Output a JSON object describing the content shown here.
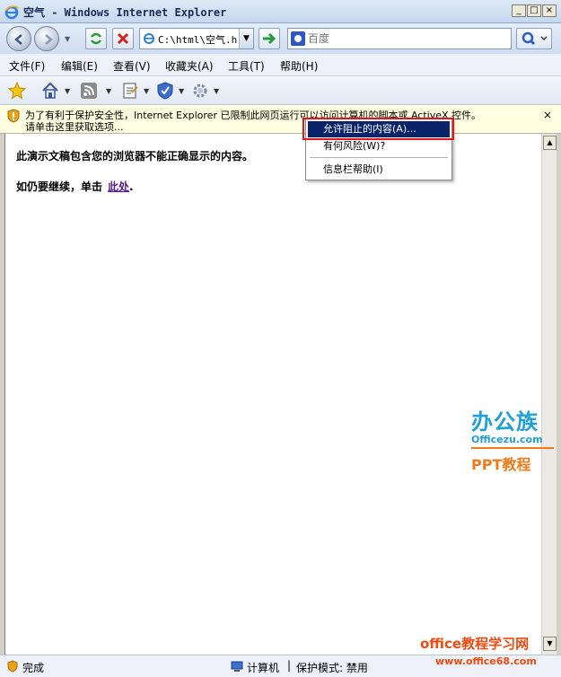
{
  "window": {
    "title": "空气 - Windows Internet Explorer",
    "min_label": "_",
    "max_label": "□",
    "close_label": "×"
  },
  "address": {
    "url": "C:\\html\\空气.ht",
    "search_placeholder": "百度"
  },
  "menu": [
    {
      "label": "文件(F)"
    },
    {
      "label": "编辑(E)"
    },
    {
      "label": "查看(V)"
    },
    {
      "label": "收藏夹(A)"
    },
    {
      "label": "工具(T)"
    },
    {
      "label": "帮助(H)"
    }
  ],
  "command_icons": [
    "favorites-star-icon",
    "home-icon",
    "rss-feed-icon",
    "page-icon",
    "safety-shield-icon",
    "tools-gear-icon"
  ],
  "infobar": {
    "line1": "为了有利于保护安全性，Internet Explorer 已限制此网页运行可以访问计算机的脚本或 ActiveX 控件。",
    "line2": "请单击这里获取选项...",
    "close": "×"
  },
  "context_menu": {
    "items": [
      {
        "label": "允许阻止的内容(A)..."
      },
      {
        "label": "有何风险(W)?"
      },
      {
        "label": "信息栏帮助(I)"
      }
    ]
  },
  "content": {
    "line1": "此演示文稿包含您的浏览器不能正确显示的内容。",
    "line2_prefix": "如仍要继续，单击",
    "link": "此处",
    "line2_suffix": "."
  },
  "watermark": {
    "logo_big": "办公族",
    "logo_domain": "Officezu.com",
    "logo_ppt": "PPT教程",
    "site_name": "office教程学习网",
    "site_url": "www.office68.com"
  },
  "status": {
    "done": "完成",
    "zone": "计算机",
    "separator": "|",
    "protected_mode": "保护模式: 禁用"
  },
  "colors": {
    "selection": "#0a246a",
    "highlight_box": "#e8141b",
    "infobar_bg": "#ffffe1",
    "link": "#551a8b"
  }
}
